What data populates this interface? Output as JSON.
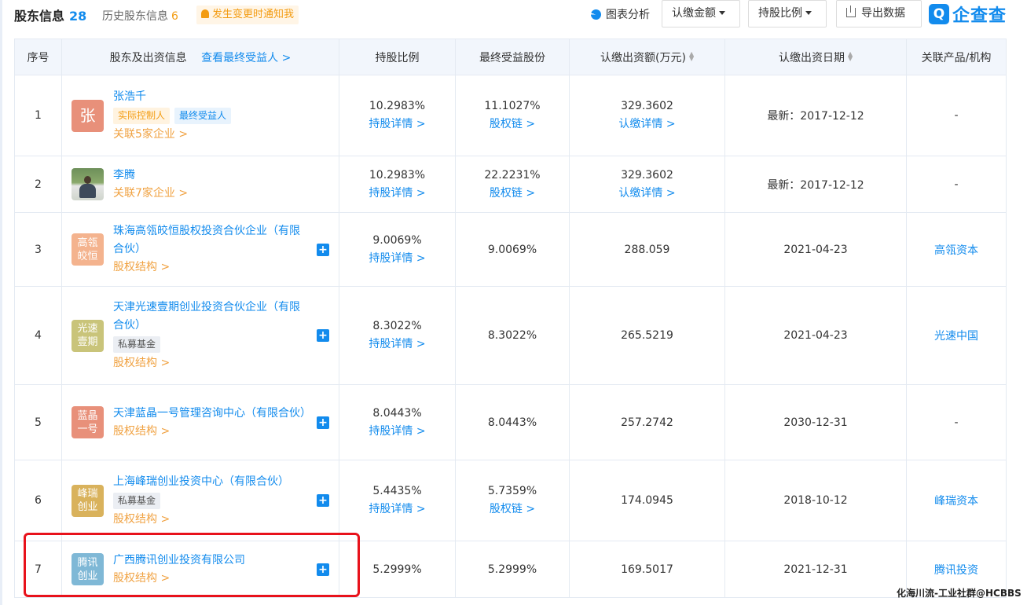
{
  "tabs": {
    "active_label": "股东信息",
    "active_count": "28",
    "history_label": "历史股东信息",
    "history_count": "6",
    "notify_label": "发生变更时通知我"
  },
  "toolbar": {
    "chart_label": "图表分析",
    "subscribed_amount_label": "认缴金额",
    "share_ratio_label": "持股比例",
    "export_label": "导出数据",
    "logo_mark": "Q",
    "logo_text": "企查查"
  },
  "table": {
    "headers": {
      "seq": "序号",
      "holder": "股东及出资信息",
      "beneficiary_link": "查看最终受益人 >",
      "ratio": "持股比例",
      "final_share": "最终受益股份",
      "amount": "认缴出资额(万元)",
      "date": "认缴出资日期",
      "related": "关联产品/机构"
    },
    "rows": [
      {
        "seq": "1",
        "avatar": "张",
        "avatar_color": "#e8907a",
        "name": "张浩千",
        "tags": [
          "实际控制人",
          "最终受益人"
        ],
        "sub": "关联5家企业 >",
        "ratio": "10.2983%",
        "ratio_link": "持股详情 >",
        "final": "11.1027%",
        "final_link": "股权链 >",
        "amount": "329.3602",
        "amount_link": "认缴详情 >",
        "date": "最新：2017-12-12",
        "related": "-"
      },
      {
        "seq": "2",
        "avatar": "",
        "name": "李腾",
        "sub": "关联7家企业 >",
        "ratio": "10.2983%",
        "ratio_link": "持股详情 >",
        "final": "22.2231%",
        "final_link": "股权链 >",
        "amount": "329.3602",
        "amount_link": "认缴详情 >",
        "date": "最新：2017-12-12",
        "related": "-"
      },
      {
        "seq": "3",
        "avatar_line1": "高瓴",
        "avatar_line2": "皎恒",
        "avatar_color": "#f4b38e",
        "name": "珠海高瓴皎恒股权投资合伙企业（有限合伙）",
        "sub": "股权结构 >",
        "ratio": "9.0069%",
        "ratio_link": "持股详情 >",
        "final": "9.0069%",
        "amount": "288.059",
        "date": "2021-04-23",
        "related": "高瓴资本"
      },
      {
        "seq": "4",
        "avatar_line1": "光速",
        "avatar_line2": "壹期",
        "avatar_color": "#c9c47a",
        "name": "天津光速壹期创业投资合伙企业（有限合伙）",
        "tag": "私募基金",
        "sub": "股权结构 >",
        "ratio": "8.3022%",
        "ratio_link": "持股详情 >",
        "final": "8.3022%",
        "amount": "265.5219",
        "date": "2021-04-23",
        "related": "光速中国"
      },
      {
        "seq": "5",
        "avatar_line1": "蓝晶",
        "avatar_line2": "一号",
        "avatar_color": "#e8907a",
        "name": "天津蓝晶一号管理咨询中心（有限合伙）",
        "sub": "股权结构 >",
        "ratio": "8.0443%",
        "ratio_link": "持股详情 >",
        "final": "8.0443%",
        "amount": "257.2742",
        "date": "2030-12-31",
        "related": "-"
      },
      {
        "seq": "6",
        "avatar_line1": "峰瑞",
        "avatar_line2": "创业",
        "avatar_color": "#d9b25c",
        "name": "上海峰瑞创业投资中心（有限合伙）",
        "tag": "私募基金",
        "sub": "股权结构 >",
        "ratio": "5.4435%",
        "ratio_link": "持股详情 >",
        "final": "5.7359%",
        "final_link": "股权链 >",
        "amount": "174.0945",
        "date": "2018-10-12",
        "related": "峰瑞资本"
      },
      {
        "seq": "7",
        "avatar_line1": "腾讯",
        "avatar_line2": "创业",
        "avatar_color": "#7fb8d6",
        "name": "广西腾讯创业投资有限公司",
        "sub": "股权结构 >",
        "ratio": "5.2999%",
        "final": "5.2999%",
        "amount": "169.5017",
        "date": "2021-12-31",
        "related": "腾讯投资"
      }
    ]
  },
  "watermark": "化海川流-工业社群@HCBBS"
}
